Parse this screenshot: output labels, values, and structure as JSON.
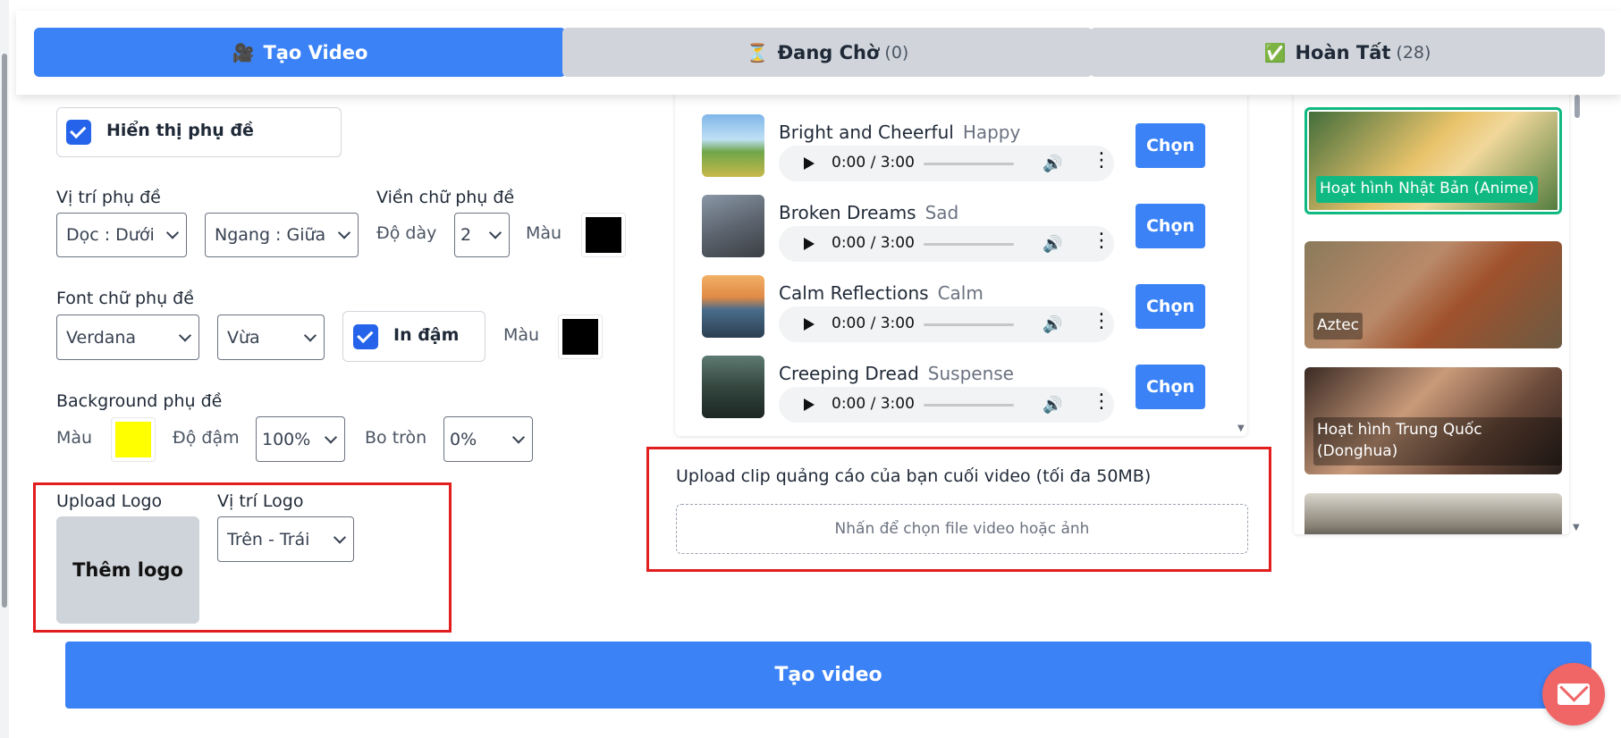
{
  "tabs": {
    "create": {
      "icon": "🎥",
      "label": "Tạo Video"
    },
    "waiting": {
      "icon": "⏳",
      "label": "Đang Chờ",
      "count": "(0)"
    },
    "done": {
      "icon": "✅",
      "label": "Hoàn Tất",
      "count": "(28)"
    }
  },
  "subtitle": {
    "show_label": "Hiển thị phụ đề",
    "position_label": "Vị trí phụ đề",
    "vertical_value": "Dọc : Dưới",
    "horizontal_value": "Ngang : Giữa",
    "outline_label": "Viền chữ phụ đề",
    "thickness_label": "Độ dày",
    "thickness_value": "2",
    "outline_color_label": "Màu",
    "outline_color": "#000000",
    "font_label": "Font chữ phụ đề",
    "font_value": "Verdana",
    "size_value": "Vừa",
    "bold_label": "In đậm",
    "font_color_label": "Màu",
    "font_color": "#000000",
    "bg_label": "Background phụ đề",
    "bg_color_label": "Màu",
    "bg_color": "#ffff00",
    "opacity_label": "Độ đậm",
    "opacity_value": "100%",
    "radius_label": "Bo tròn",
    "radius_value": "0%"
  },
  "logo": {
    "upload_label": "Upload Logo",
    "add_label": "Thêm logo",
    "position_label": "Vị trí Logo",
    "position_value": "Trên - Trái"
  },
  "music": {
    "choose_label": "Chọn",
    "tracks": [
      {
        "title": "Bright and Cheerful",
        "mood": "Happy",
        "time": "0:00 / 3:00"
      },
      {
        "title": "Broken Dreams",
        "mood": "Sad",
        "time": "0:00 / 3:00"
      },
      {
        "title": "Calm Reflections",
        "mood": "Calm",
        "time": "0:00 / 3:00"
      },
      {
        "title": "Creeping Dread",
        "mood": "Suspense",
        "time": "0:00 / 3:00"
      }
    ]
  },
  "ad_clip": {
    "label": "Upload clip quảng cáo của bạn cuối video (tối đa 50MB)",
    "placeholder": "Nhấn để chọn file video hoặc ảnh"
  },
  "styles": [
    {
      "label": "Hoạt hình Nhật Bản (Anime)",
      "selected": true
    },
    {
      "label": "Aztec",
      "selected": false
    },
    {
      "label": "Hoạt hình Trung Quốc (Donghua)",
      "selected": false
    }
  ],
  "create_button": "Tạo video",
  "colors": {
    "accent": "#3b82f6",
    "highlight": "#e11d1d",
    "selected": "#10b981"
  }
}
